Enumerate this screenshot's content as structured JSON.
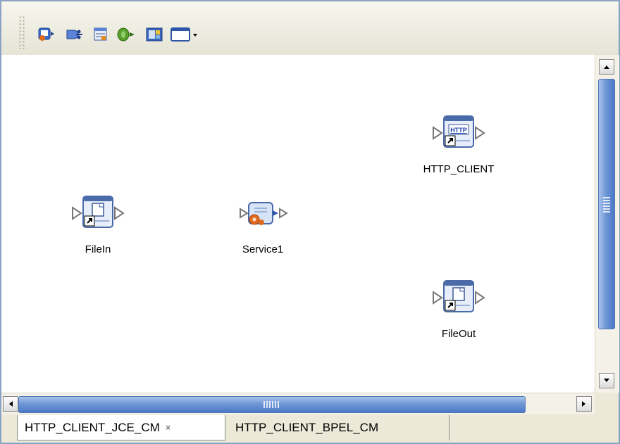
{
  "toolbar": {
    "buttons": [
      {
        "icon": "add-service-icon"
      },
      {
        "icon": "add-connector-icon"
      },
      {
        "icon": "add-table-icon"
      },
      {
        "icon": "add-database-icon"
      },
      {
        "icon": "add-image-icon"
      },
      {
        "icon": "window-dropdown-icon"
      }
    ]
  },
  "canvas": {
    "nodes": {
      "http_client": {
        "label": "HTTP_CLIENT",
        "badge": "HTTP"
      },
      "file_in": {
        "label": "FileIn"
      },
      "service1": {
        "label": "Service1"
      },
      "file_out": {
        "label": "FileOut"
      }
    }
  },
  "tabs": {
    "active": {
      "label": "HTTP_CLIENT_JCE_CM",
      "close": "×"
    },
    "inactive": {
      "label": "HTTP_CLIENT_BPEL_CM"
    }
  },
  "colors": {
    "frame_border": "#8aa2c4",
    "scroll_thumb": "#6f97d6",
    "window_bg": "#ece9d8"
  }
}
